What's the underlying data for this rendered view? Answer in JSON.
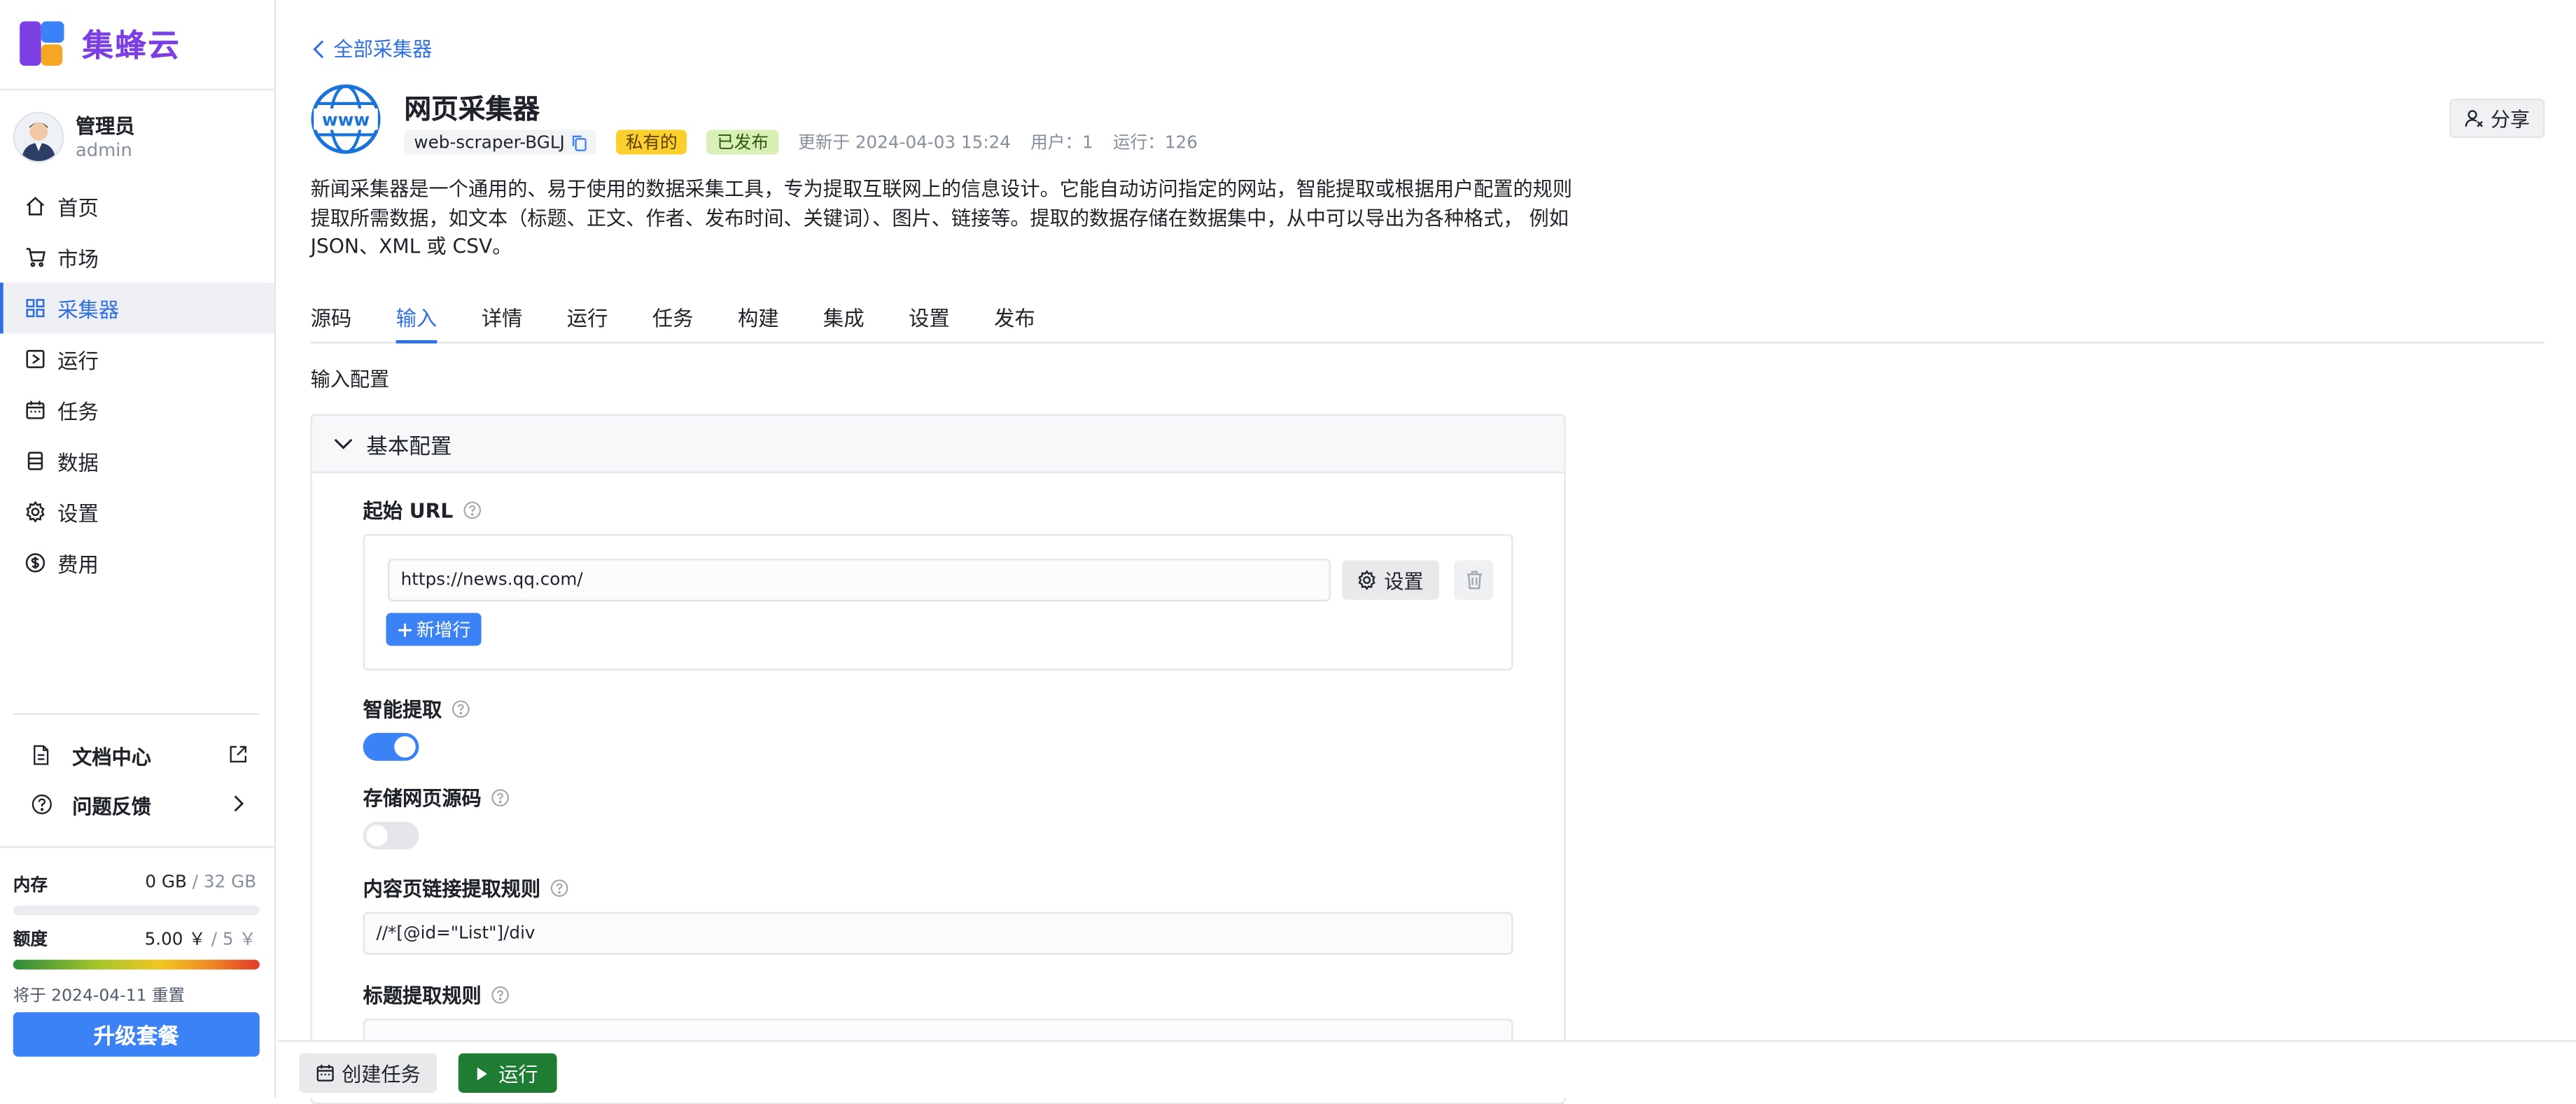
{
  "app": {
    "name": "集蜂云",
    "brand_color": "#7b3fe4",
    "accent_color": "#3b82f6"
  },
  "user": {
    "name": "管理员",
    "username": "admin"
  },
  "nav": {
    "items": [
      {
        "label": "首页",
        "icon": "home-icon"
      },
      {
        "label": "市场",
        "icon": "cart-icon"
      },
      {
        "label": "采集器",
        "icon": "collector-icon",
        "active": true
      },
      {
        "label": "运行",
        "icon": "run-icon"
      },
      {
        "label": "任务",
        "icon": "calendar-icon"
      },
      {
        "label": "数据",
        "icon": "database-icon"
      },
      {
        "label": "设置",
        "icon": "gear-icon"
      },
      {
        "label": "费用",
        "icon": "dollar-icon"
      }
    ]
  },
  "sidebar_links": {
    "docs": "文档中心",
    "feedback": "问题反馈"
  },
  "usage": {
    "memory_label": "内存",
    "memory_used": "0 GB",
    "memory_total": "/ 32 GB",
    "memory_fraction": 0,
    "quota_label": "额度",
    "quota_used": "5.00 ￥",
    "quota_total": "/ 5 ￥",
    "quota_fraction": 1.0,
    "reset_note": "将于 2024-04-11 重置",
    "upgrade_label": "升级套餐"
  },
  "header": {
    "back_label": "全部采集器",
    "title": "网页采集器",
    "id_chip": "web-scraper-BGLJ",
    "private_badge": "私有的",
    "published_badge": "已发布",
    "updated": "更新于 2024-04-03 15:24",
    "users": "用户：1",
    "runs": "运行：126",
    "share_label": "分享",
    "description": "新闻采集器是一个通用的、易于使用的数据采集工具，专为提取互联网上的信息设计。它能自动访问指定的网站，智能提取或根据用户配置的规则提取所需数据，如文本（标题、正文、作者、发布时间、关键词）、图片、链接等。提取的数据存储在数据集中，从中可以导出为各种格式， 例如 JSON、XML 或 CSV。"
  },
  "tabs": [
    "源码",
    "输入",
    "详情",
    "运行",
    "任务",
    "构建",
    "集成",
    "设置",
    "发布"
  ],
  "active_tab": "输入",
  "input_config": {
    "section_label": "输入配置",
    "panel_title": "基本配置",
    "start_url": {
      "label": "起始 URL",
      "value": "https://news.qq.com/",
      "settings_label": "设置",
      "add_row_label": "新增行"
    },
    "smart_extract": {
      "label": "智能提取",
      "enabled": true
    },
    "store_source": {
      "label": "存储网页源码",
      "enabled": false
    },
    "link_rule": {
      "label": "内容页链接提取规则",
      "value": "//*[@id=\"List\"]/div"
    },
    "title_rule": {
      "label": "标题提取规则",
      "value": ""
    }
  },
  "footer": {
    "create_task_label": "创建任务",
    "run_label": "运行"
  }
}
